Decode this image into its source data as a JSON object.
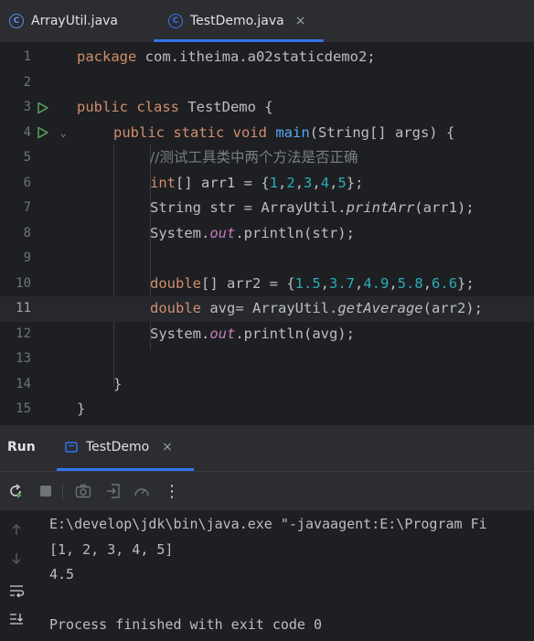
{
  "tabs": [
    {
      "label": "ArrayUtil.java",
      "icon": "class-icon",
      "active": false
    },
    {
      "label": "TestDemo.java",
      "icon": "class-icon",
      "active": true,
      "close": "×"
    }
  ],
  "editor": {
    "current_line": 11,
    "line_numbers": [
      "1",
      "2",
      "3",
      "4",
      "5",
      "6",
      "7",
      "8",
      "9",
      "10",
      "11",
      "12",
      "13",
      "14",
      "15"
    ],
    "code": {
      "l1_kw": "package",
      "l1_rest": " com.itheima.a02staticdemo2;",
      "l3_kw": "public class",
      "l3_rest": " TestDemo {",
      "l4_kw": "public static void",
      "l4_fn": "main",
      "l4_rest": "(String[] args) {",
      "l5_cmt": "//测试工具类中两个方法是否正确",
      "l6_kw": "int",
      "l6_a": "[] arr1 = {",
      "l6_n1": "1",
      "l6_n2": "2",
      "l6_n3": "3",
      "l6_n4": "4",
      "l6_n5": "5",
      "l6_end": "};",
      "l7_a": "String str = ArrayUtil.",
      "l7_m": "printArr",
      "l7_end": "(arr1);",
      "l8_a": "System.",
      "l8_f": "out",
      "l8_end": ".println(str);",
      "l10_kw": "double",
      "l10_a": "[] arr2 = {",
      "l10_n1": "1.5",
      "l10_n2": "3.7",
      "l10_n3": "4.9",
      "l10_n4": "5.8",
      "l10_n5": "6.6",
      "l10_end": "};",
      "l11_kw": "double",
      "l11_a": " avg= ArrayUtil.",
      "l11_m": "getAverage",
      "l11_end": "(arr2);",
      "l12_a": "System.",
      "l12_f": "out",
      "l12_end": ".println(avg);",
      "l14": "}",
      "l15": "}",
      "comma": ","
    }
  },
  "run_panel": {
    "title": "Run",
    "tab_label": "TestDemo",
    "tab_close": "×",
    "more": "⋮"
  },
  "console": {
    "lines": [
      "E:\\develop\\jdk\\bin\\java.exe \"-javaagent:E:\\Program Fi",
      "[1, 2, 3, 4, 5]",
      "4.5",
      "",
      "Process finished with exit code 0"
    ]
  },
  "colors": {
    "accent": "#3574f0",
    "run_green": "#57965c",
    "background": "#1e1f22"
  }
}
